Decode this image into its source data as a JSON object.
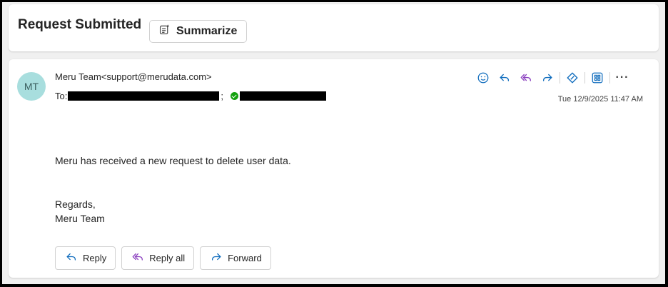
{
  "subject": {
    "title": "Request Submitted",
    "summarize_label": "Summarize"
  },
  "message": {
    "avatar_initials": "MT",
    "sender_name": "Meru Team",
    "sender_email": "<support@merudata.com>",
    "to_label": "To:",
    "separator": ";",
    "timestamp": "Tue 12/9/2025 11:47 AM",
    "body_line": "Meru has received a new request to delete user data.",
    "signoff": "Regards,",
    "signature": "Meru Team"
  },
  "toolbar": {
    "icons": [
      "emoji-icon",
      "reply-icon",
      "reply-all-icon",
      "forward-icon",
      "loop-icon",
      "apps-icon",
      "more-icon"
    ],
    "accent_color": "#0f6cbd",
    "reply_all_color": "#8a3fbf"
  },
  "actions": {
    "reply_label": "Reply",
    "reply_all_label": "Reply all",
    "forward_label": "Forward"
  }
}
